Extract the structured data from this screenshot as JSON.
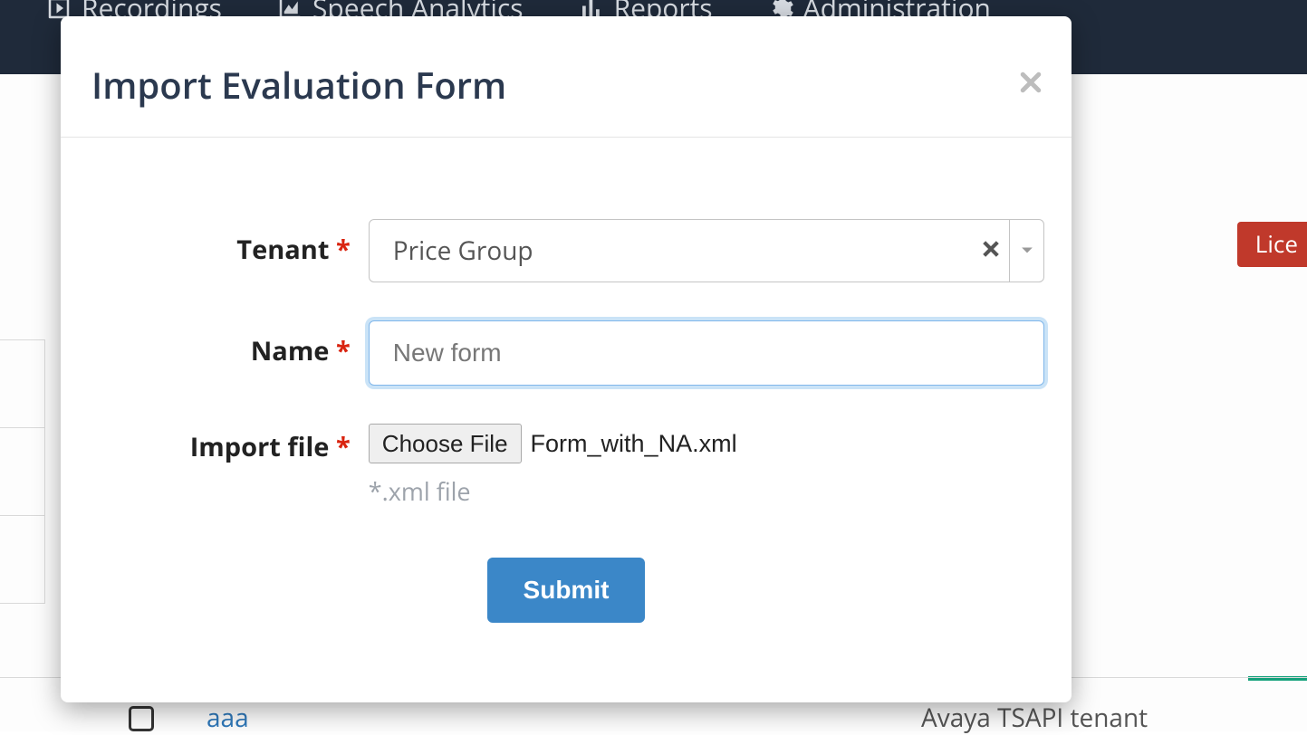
{
  "nav": {
    "recordings": "Recordings",
    "speech": "Speech Analytics",
    "reports": "Reports",
    "admin": "Administration"
  },
  "license_btn": "Lice",
  "modal": {
    "title": "Import Evaluation Form",
    "tenant_label": "Tenant",
    "tenant_value": "Price Group",
    "name_label": "Name",
    "name_value": "New form",
    "file_label": "Import file",
    "choose_label": "Choose File",
    "file_name": "Form_with_NA.xml",
    "file_hint": "*.xml file",
    "submit_label": "Submit",
    "required_mark": "*"
  },
  "bg_row": {
    "link_text": "aaa",
    "tenant_text": "Avaya TSAPI tenant"
  }
}
